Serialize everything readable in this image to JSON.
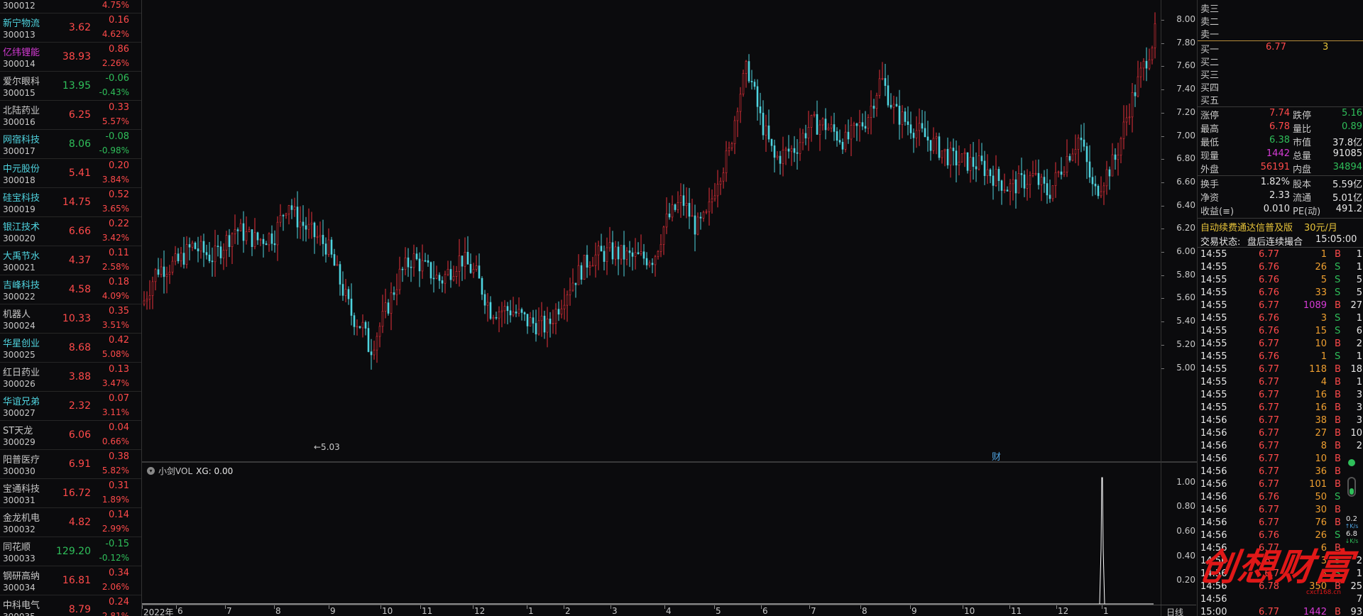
{
  "stocks": [
    {
      "name": "",
      "code": "300012",
      "price": "",
      "change": "",
      "pct": "4.75%",
      "name_color": "#c8c8c8",
      "color": "#ff4a4a"
    },
    {
      "name": "新宁物流",
      "code": "300013",
      "price": "3.62",
      "change": "0.16",
      "pct": "4.62%",
      "name_color": "#4fd4e0",
      "color": "#ff4a4a"
    },
    {
      "name": "亿纬锂能",
      "code": "300014",
      "price": "38.93",
      "change": "0.86",
      "pct": "2.26%",
      "name_color": "#d63bd6",
      "color": "#ff4a4a"
    },
    {
      "name": "爱尔眼科",
      "code": "300015",
      "price": "13.95",
      "change": "-0.06",
      "pct": "-0.43%",
      "name_color": "#c8c8c8",
      "color": "#2fbf5a"
    },
    {
      "name": "北陆药业",
      "code": "300016",
      "price": "6.25",
      "change": "0.33",
      "pct": "5.57%",
      "name_color": "#c8c8c8",
      "color": "#ff4a4a"
    },
    {
      "name": "网宿科技",
      "code": "300017",
      "price": "8.06",
      "change": "-0.08",
      "pct": "-0.98%",
      "name_color": "#4fd4e0",
      "color": "#2fbf5a"
    },
    {
      "name": "中元股份",
      "code": "300018",
      "price": "5.41",
      "change": "0.20",
      "pct": "3.84%",
      "name_color": "#4fd4e0",
      "color": "#ff4a4a"
    },
    {
      "name": "硅宝科技",
      "code": "300019",
      "price": "14.75",
      "change": "0.52",
      "pct": "3.65%",
      "name_color": "#4fd4e0",
      "color": "#ff4a4a"
    },
    {
      "name": "银江技术",
      "code": "300020",
      "price": "6.66",
      "change": "0.22",
      "pct": "3.42%",
      "name_color": "#4fd4e0",
      "color": "#ff4a4a"
    },
    {
      "name": "大禹节水",
      "code": "300021",
      "price": "4.37",
      "change": "0.11",
      "pct": "2.58%",
      "name_color": "#4fd4e0",
      "color": "#ff4a4a"
    },
    {
      "name": "吉峰科技",
      "code": "300022",
      "price": "4.58",
      "change": "0.18",
      "pct": "4.09%",
      "name_color": "#4fd4e0",
      "color": "#ff4a4a"
    },
    {
      "name": "机器人",
      "code": "300024",
      "price": "10.33",
      "change": "0.35",
      "pct": "3.51%",
      "name_color": "#c8c8c8",
      "color": "#ff4a4a"
    },
    {
      "name": "华星创业",
      "code": "300025",
      "price": "8.68",
      "change": "0.42",
      "pct": "5.08%",
      "name_color": "#4fd4e0",
      "color": "#ff4a4a"
    },
    {
      "name": "红日药业",
      "code": "300026",
      "price": "3.88",
      "change": "0.13",
      "pct": "3.47%",
      "name_color": "#c8c8c8",
      "color": "#ff4a4a"
    },
    {
      "name": "华谊兄弟",
      "code": "300027",
      "price": "2.32",
      "change": "0.07",
      "pct": "3.11%",
      "name_color": "#4fd4e0",
      "color": "#ff4a4a"
    },
    {
      "name": "ST天龙",
      "code": "300029",
      "price": "6.06",
      "change": "0.04",
      "pct": "0.66%",
      "name_color": "#c8c8c8",
      "color": "#ff4a4a"
    },
    {
      "name": "阳普医疗",
      "code": "300030",
      "price": "6.91",
      "change": "0.38",
      "pct": "5.82%",
      "name_color": "#c8c8c8",
      "color": "#ff4a4a"
    },
    {
      "name": "宝通科技",
      "code": "300031",
      "price": "16.72",
      "change": "0.31",
      "pct": "1.89%",
      "name_color": "#c8c8c8",
      "color": "#ff4a4a"
    },
    {
      "name": "金龙机电",
      "code": "300032",
      "price": "4.82",
      "change": "0.14",
      "pct": "2.99%",
      "name_color": "#c8c8c8",
      "color": "#ff4a4a"
    },
    {
      "name": "同花顺",
      "code": "300033",
      "price": "129.20",
      "change": "-0.15",
      "pct": "-0.12%",
      "name_color": "#c8c8c8",
      "color": "#2fbf5a"
    },
    {
      "name": "钢研高纳",
      "code": "300034",
      "price": "16.81",
      "change": "0.34",
      "pct": "2.06%",
      "name_color": "#c8c8c8",
      "color": "#ff4a4a"
    },
    {
      "name": "中科电气",
      "code": "300035",
      "price": "8.79",
      "change": "0.24",
      "pct": "2.81%",
      "name_color": "#c8c8c8",
      "color": "#ff4a4a"
    }
  ],
  "price_axis": [
    "8.00",
    "7.80",
    "7.60",
    "7.40",
    "7.20",
    "7.00",
    "6.80",
    "6.60",
    "6.40",
    "6.20",
    "6.00",
    "5.80",
    "5.60",
    "5.40",
    "5.20",
    "5.00"
  ],
  "vol_axis": [
    "1.00",
    "0.80",
    "0.60",
    "0.40",
    "0.20"
  ],
  "time_axis": [
    "2022年",
    "6",
    "7",
    "8",
    "9",
    "10",
    "11",
    "12",
    "1",
    "2",
    "3",
    "4",
    "5",
    "6",
    "7",
    "8",
    "9",
    "10",
    "11",
    "12",
    "1"
  ],
  "time_axis_right": "日线",
  "low_marker": "5.03",
  "fin_marker": "财",
  "vol_indicator": {
    "name": "小剑VOL",
    "param": "XG: 0.00"
  },
  "orderbook": {
    "sells": [
      {
        "label": "卖三"
      },
      {
        "label": "卖二"
      },
      {
        "label": "卖一"
      }
    ],
    "buys": [
      {
        "label": "买一",
        "price": "6.77",
        "vol": "3"
      },
      {
        "label": "买二"
      },
      {
        "label": "买三"
      },
      {
        "label": "买四"
      },
      {
        "label": "买五"
      }
    ]
  },
  "stats": [
    {
      "l1": "涨停",
      "v1": "7.74",
      "c1": "red",
      "l2": "跌停",
      "v2": "5.16",
      "c2": "green"
    },
    {
      "l1": "最高",
      "v1": "6.78",
      "c1": "red",
      "l2": "量比",
      "v2": "0.89",
      "c2": "green"
    },
    {
      "l1": "最低",
      "v1": "6.38",
      "c1": "green",
      "l2": "市值",
      "v2": "37.8亿",
      "c2": "white"
    },
    {
      "l1": "现量",
      "v1": "1442",
      "c1": "magenta",
      "l2": "总量",
      "v2": "91085",
      "c2": "white"
    },
    {
      "l1": "外盘",
      "v1": "56191",
      "c1": "red",
      "l2": "内盘",
      "v2": "34894",
      "c2": "green"
    },
    {
      "l1": "换手",
      "v1": "1.82%",
      "c1": "white",
      "l2": "股本",
      "v2": "5.59亿",
      "c2": "white"
    },
    {
      "l1": "净资",
      "v1": "2.33",
      "c1": "white",
      "l2": "流通",
      "v2": "5.01亿",
      "c2": "white"
    },
    {
      "l1": "收益(≡)",
      "v1": "0.010",
      "c1": "white",
      "l2": "PE(动)",
      "v2": "491.2",
      "c2": "white"
    }
  ],
  "promo": {
    "text": "自动续费通达信普及版",
    "price": "30元/月"
  },
  "trade_status": {
    "label": "交易状态:",
    "value": "盘后连续撮合",
    "time": "15:05:00"
  },
  "ticks": [
    {
      "t": "14:55",
      "p": "6.77",
      "v": "1",
      "s": "B",
      "n": "1",
      "pc": "red",
      "vc": "orange",
      "sc": "red"
    },
    {
      "t": "14:55",
      "p": "6.76",
      "v": "26",
      "s": "S",
      "n": "1",
      "pc": "red",
      "vc": "orange",
      "sc": "green"
    },
    {
      "t": "14:55",
      "p": "6.76",
      "v": "5",
      "s": "S",
      "n": "5",
      "pc": "red",
      "vc": "orange",
      "sc": "green"
    },
    {
      "t": "14:55",
      "p": "6.76",
      "v": "33",
      "s": "S",
      "n": "5",
      "pc": "red",
      "vc": "orange",
      "sc": "green"
    },
    {
      "t": "14:55",
      "p": "6.77",
      "v": "1089",
      "s": "B",
      "n": "27",
      "pc": "red",
      "vc": "magenta",
      "sc": "red"
    },
    {
      "t": "14:55",
      "p": "6.76",
      "v": "3",
      "s": "S",
      "n": "1",
      "pc": "red",
      "vc": "orange",
      "sc": "green"
    },
    {
      "t": "14:55",
      "p": "6.76",
      "v": "15",
      "s": "S",
      "n": "6",
      "pc": "red",
      "vc": "orange",
      "sc": "green"
    },
    {
      "t": "14:55",
      "p": "6.77",
      "v": "10",
      "s": "B",
      "n": "2",
      "pc": "red",
      "vc": "orange",
      "sc": "red"
    },
    {
      "t": "14:55",
      "p": "6.76",
      "v": "1",
      "s": "S",
      "n": "1",
      "pc": "red",
      "vc": "orange",
      "sc": "green"
    },
    {
      "t": "14:55",
      "p": "6.77",
      "v": "118",
      "s": "B",
      "n": "18",
      "pc": "red",
      "vc": "orange",
      "sc": "red"
    },
    {
      "t": "14:55",
      "p": "6.77",
      "v": "4",
      "s": "B",
      "n": "1",
      "pc": "red",
      "vc": "orange",
      "sc": "red"
    },
    {
      "t": "14:55",
      "p": "6.77",
      "v": "16",
      "s": "B",
      "n": "3",
      "pc": "red",
      "vc": "orange",
      "sc": "red"
    },
    {
      "t": "14:55",
      "p": "6.77",
      "v": "16",
      "s": "B",
      "n": "3",
      "pc": "red",
      "vc": "orange",
      "sc": "red"
    },
    {
      "t": "14:56",
      "p": "6.77",
      "v": "38",
      "s": "B",
      "n": "3",
      "pc": "red",
      "vc": "orange",
      "sc": "red"
    },
    {
      "t": "14:56",
      "p": "6.77",
      "v": "27",
      "s": "B",
      "n": "10",
      "pc": "red",
      "vc": "orange",
      "sc": "red"
    },
    {
      "t": "14:56",
      "p": "6.77",
      "v": "8",
      "s": "B",
      "n": "2",
      "pc": "red",
      "vc": "orange",
      "sc": "red"
    },
    {
      "t": "14:56",
      "p": "6.77",
      "v": "10",
      "s": "B",
      "n": "",
      "pc": "red",
      "vc": "orange",
      "sc": "red"
    },
    {
      "t": "14:56",
      "p": "6.77",
      "v": "36",
      "s": "B",
      "n": "",
      "pc": "red",
      "vc": "orange",
      "sc": "red"
    },
    {
      "t": "14:56",
      "p": "6.77",
      "v": "101",
      "s": "B",
      "n": "",
      "pc": "red",
      "vc": "orange",
      "sc": "red"
    },
    {
      "t": "14:56",
      "p": "6.76",
      "v": "50",
      "s": "S",
      "n": "",
      "pc": "red",
      "vc": "orange",
      "sc": "green"
    },
    {
      "t": "14:56",
      "p": "6.77",
      "v": "30",
      "s": "B",
      "n": "",
      "pc": "red",
      "vc": "orange",
      "sc": "red"
    },
    {
      "t": "14:56",
      "p": "6.77",
      "v": "76",
      "s": "B",
      "n": "",
      "pc": "red",
      "vc": "orange",
      "sc": "red"
    },
    {
      "t": "14:56",
      "p": "6.76",
      "v": "26",
      "s": "S",
      "n": "",
      "pc": "red",
      "vc": "orange",
      "sc": "green"
    },
    {
      "t": "14:56",
      "p": "6.77",
      "v": "6",
      "s": "B",
      "n": "",
      "pc": "red",
      "vc": "orange",
      "sc": "red"
    },
    {
      "t": "14:56",
      "p": "6.7",
      "v": "3",
      "s": "S",
      "n": "2",
      "pc": "red",
      "vc": "orange",
      "sc": "green"
    },
    {
      "t": "14:56",
      "p": "6.7",
      "v": "3",
      "s": "S",
      "n": "1",
      "pc": "red",
      "vc": "orange",
      "sc": "green"
    },
    {
      "t": "14:56",
      "p": "6.78",
      "v": "350",
      "s": "B",
      "n": "25",
      "pc": "red",
      "vc": "orange",
      "sc": "red"
    },
    {
      "t": "14:56",
      "p": "",
      "v": "",
      "s": "",
      "n": "7",
      "pc": "red",
      "vc": "orange",
      "sc": "red"
    },
    {
      "t": "15:00",
      "p": "6.77",
      "v": "1442",
      "s": "B",
      "n": "93",
      "pc": "red",
      "vc": "magenta",
      "sc": "red"
    }
  ],
  "speed": {
    "up": "0.2",
    "up_unit": "K/s",
    "down": "6.8",
    "down_unit": "K/s"
  },
  "watermark": {
    "text": "创想财富",
    "url": "cxcf168.cn"
  }
}
